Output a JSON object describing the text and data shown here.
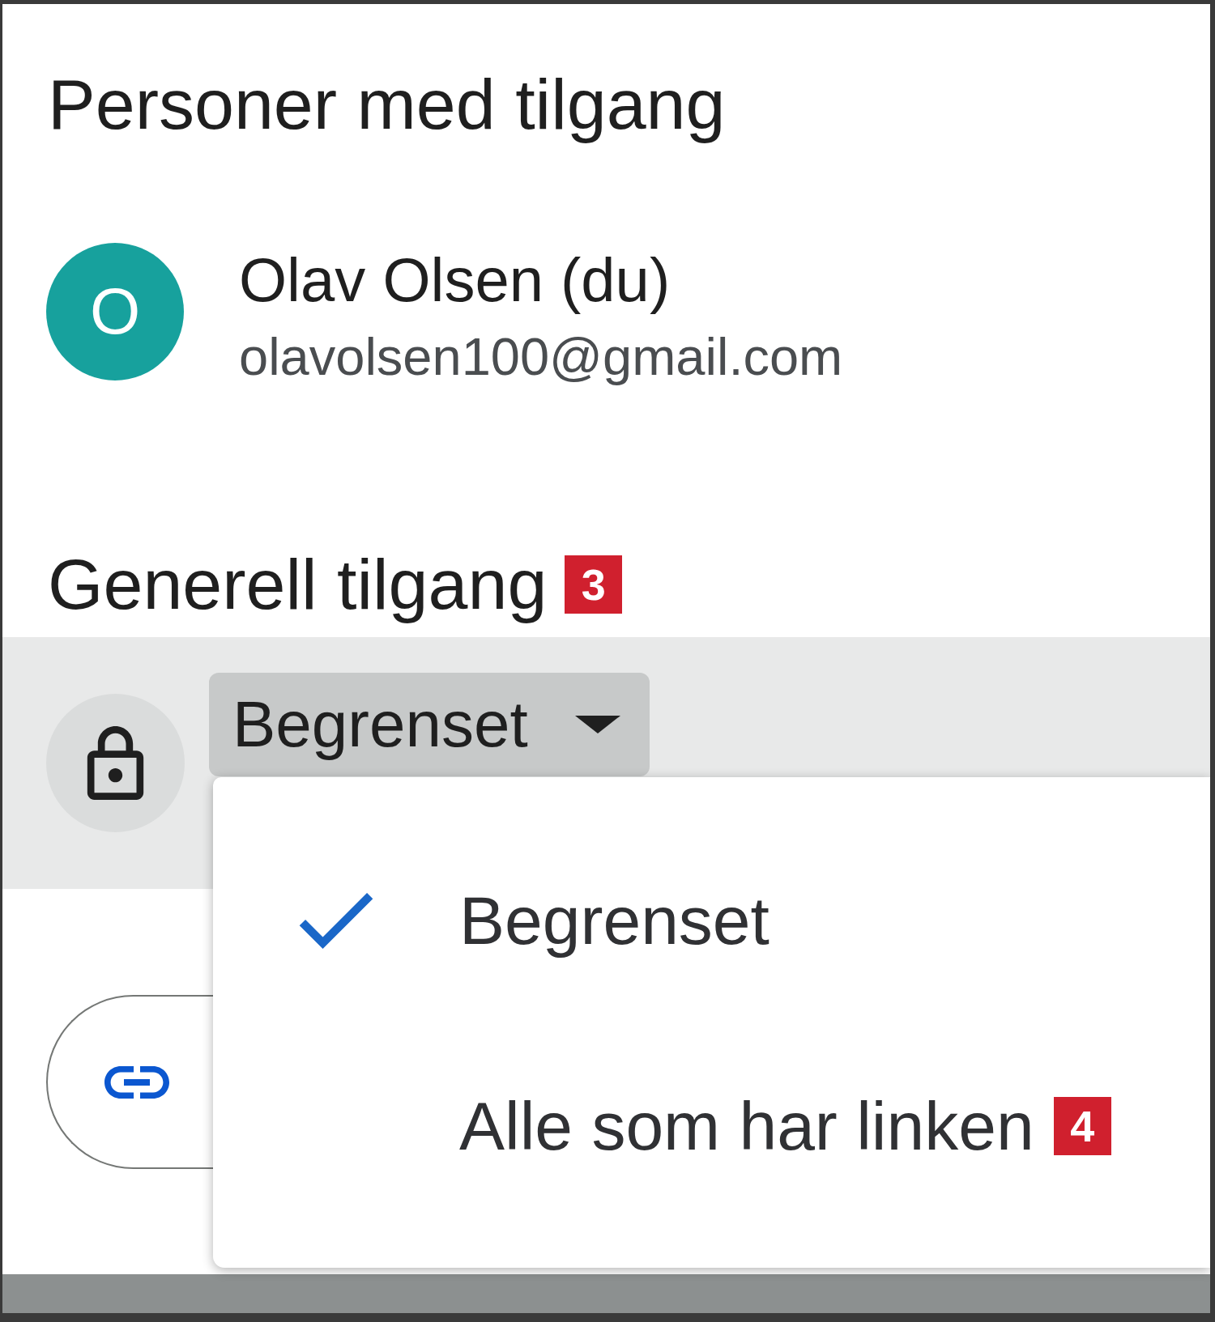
{
  "people_with_access": {
    "heading": "Personer med tilgang",
    "people": [
      {
        "avatar_letter": "O",
        "name": "Olav Olsen (du)",
        "email": "olavolsen100@gmail.com"
      }
    ]
  },
  "general_access": {
    "heading": "Generell tilgang",
    "callout": "3",
    "dropdown": {
      "value": "Begrenset",
      "expanded": true
    },
    "options": [
      {
        "label": "Begrenset",
        "selected": true
      },
      {
        "label": "Alle som har linken",
        "selected": false,
        "callout": "4"
      }
    ]
  }
}
